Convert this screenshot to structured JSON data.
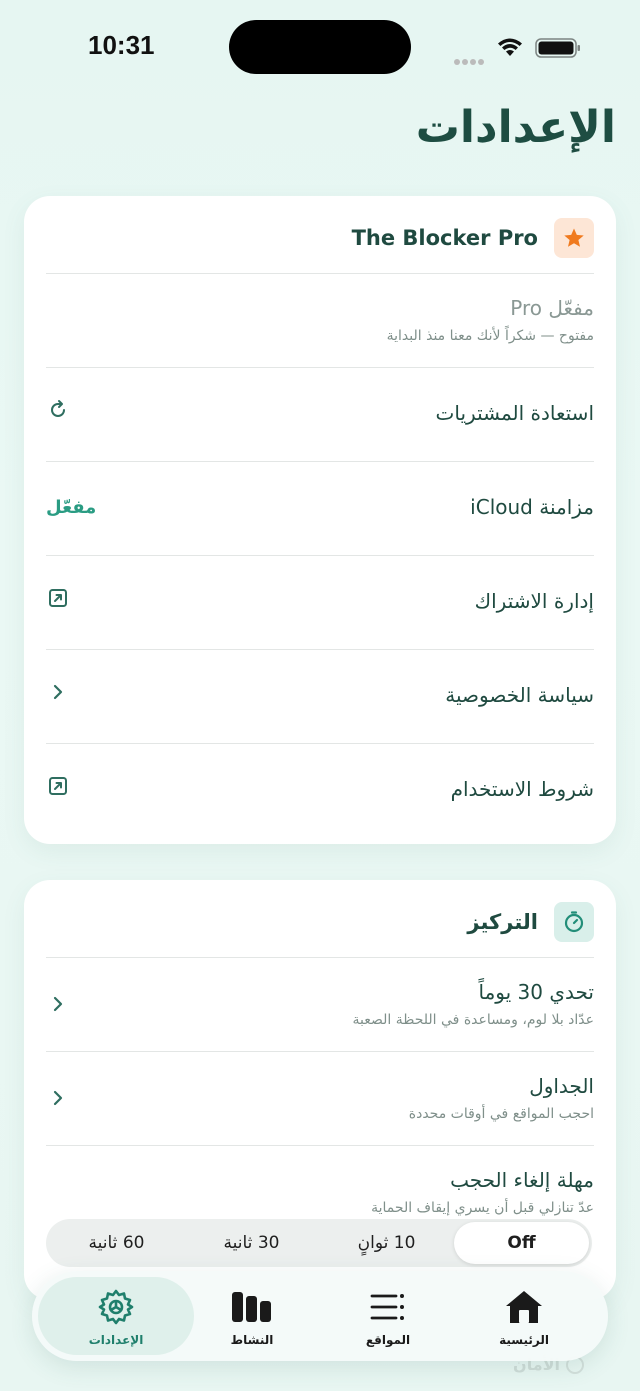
{
  "status_bar": {
    "time": "10:31"
  },
  "page_title": "الإعدادات",
  "pro_card": {
    "title": "The Blocker Pro",
    "rows": [
      {
        "title": "مفعّل Pro",
        "subtitle": "مفتوح — شكراً لأنك معنا منذ البداية"
      },
      {
        "title": "استعادة المشتريات"
      },
      {
        "title": "مزامنة iCloud",
        "value": "مفعّل"
      },
      {
        "title": "إدارة الاشتراك"
      },
      {
        "title": "سياسة الخصوصية"
      },
      {
        "title": "شروط الاستخدام"
      }
    ]
  },
  "focus_card": {
    "title": "التركيز",
    "rows": [
      {
        "title": "تحدي 30 يوماً",
        "subtitle": "عدّاد بلا لوم، ومساعدة في اللحظة الصعبة"
      },
      {
        "title": "الجداول",
        "subtitle": "احجب المواقع في أوقات محددة"
      },
      {
        "title": "مهلة إلغاء الحجب",
        "subtitle": "عدّ تنازلي قبل أن يسري إيقاف الحماية"
      }
    ],
    "delay_options": [
      "Off",
      "10 ثوانٍ",
      "30 ثانية",
      "60 ثانية"
    ],
    "delay_selected": "Off"
  },
  "ghost_section": "الأمان",
  "tabbar": {
    "home": "الرئيسية",
    "sites": "المواقع",
    "activity": "النشاط",
    "settings": "الإعدادات"
  },
  "colors": {
    "accent": "#2a9c83",
    "title": "#1e4d42",
    "star": "#f07a1e"
  }
}
